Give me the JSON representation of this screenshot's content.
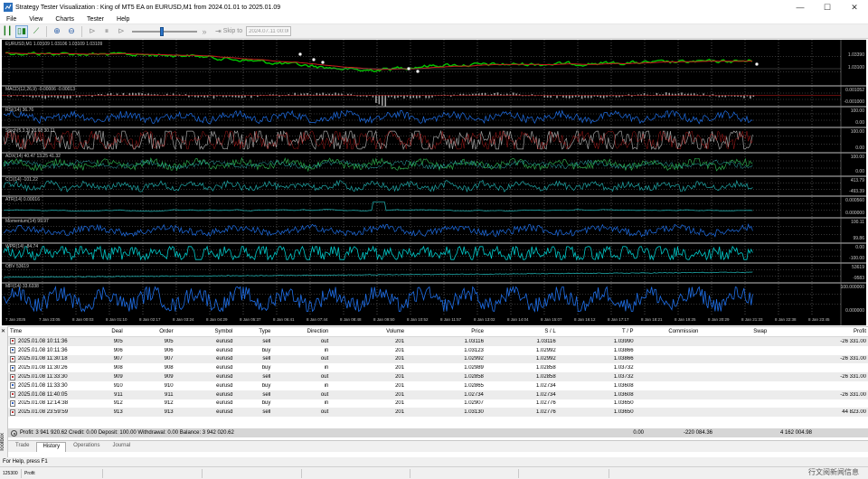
{
  "window": {
    "title": "Strategy Tester Visualization : King of MT5 EA on EURUSD,M1 from 2024.01.01 to 2025.01.09",
    "min": "—",
    "max": "☐",
    "close": "✕"
  },
  "menu": [
    "File",
    "View",
    "Charts",
    "Tester",
    "Help"
  ],
  "toolbar": {
    "skip_label": "Skip to",
    "date_value": "2024.07.11 00:00"
  },
  "speed_slider_value": 0.45,
  "chart": {
    "main_label": "EURUSD,M1   1.03109  1.03106  1.03109  1.03109",
    "main_scale": [
      "1.03390",
      "1.03100"
    ],
    "panels": [
      {
        "label": "MACD(12,26,9) -0.00006 -0.00013",
        "scale": [
          "0.001052",
          "-0.001000"
        ]
      },
      {
        "label": "RSI(14) 36.76",
        "scale": [
          "100.00",
          "0.00"
        ]
      },
      {
        "label": "Stoch(5,3,3) 20.68 30.11",
        "scale": [
          "100.00",
          "0.00"
        ]
      },
      {
        "label": "ADX(14) 40.47 13.25 41.32",
        "scale": [
          "100.00",
          "0.00"
        ]
      },
      {
        "label": "CCI(14) -101.22",
        "scale": [
          "413.79",
          "-493.39"
        ]
      },
      {
        "label": "ATR(14) 0.00016",
        "scale": [
          "0.000560",
          "0.000000"
        ]
      },
      {
        "label": "Momentum(14) 99.97",
        "scale": [
          "100.11",
          "99.86"
        ]
      },
      {
        "label": "WPR(14) -84.74",
        "scale": [
          "0.00",
          "-100.00"
        ]
      },
      {
        "label": "OBV 53619",
        "scale": [
          "53619",
          "-9583"
        ]
      },
      {
        "label": "MFI(14) 33.6338",
        "scale": [
          "100.000000",
          "0.000000"
        ]
      }
    ],
    "xaxis": [
      "7 Jan 2025",
      "7 Jan 23:05",
      "8 Jan 00:03",
      "8 Jan 01:10",
      "8 Jan 02:17",
      "8 Jan 03:24",
      "8 Jan 04:29",
      "8 Jan 05:37",
      "8 Jan 06:41",
      "8 Jan 07:44",
      "8 Jan 08:48",
      "8 Jan 09:50",
      "8 Jan 10:52",
      "8 Jan 11:57",
      "8 Jan 13:02",
      "8 Jan 14:04",
      "8 Jan 15:07",
      "8 Jan 16:12",
      "8 Jan 17:17",
      "8 Jan 18:21",
      "8 Jan 19:25",
      "8 Jan 20:29",
      "8 Jan 21:33",
      "8 Jan 22:38",
      "8 Jan 23:45"
    ],
    "colors": {
      "background": "#000000",
      "grid": "#b4b4b4",
      "price_green": "#00c800",
      "price_red": "#c81e1e",
      "indicator_blue": "#1f6fe8",
      "indicator_cyan": "#00c8c8",
      "indicator_gray": "#a0a0a0"
    }
  },
  "table": {
    "headers": [
      "Time",
      "Deal",
      "Order",
      "Symbol",
      "Type",
      "Direction",
      "Volume",
      "Price",
      "S / L",
      "T / P",
      "Commission",
      "Swap",
      "Profit"
    ],
    "rows": [
      {
        "time": "2025.01.08 10:11:36",
        "deal": "905",
        "order": "905",
        "symbol": "eurusd",
        "type": "sell",
        "direction": "out",
        "volume": "201",
        "price": "1.03116",
        "sl": "1.03116",
        "tp": "1.03990",
        "commission": "",
        "swap": "",
        "profit": "-26 331.00"
      },
      {
        "time": "2025.01.08 10:11:36",
        "deal": "906",
        "order": "906",
        "symbol": "eurusd",
        "type": "buy",
        "direction": "in",
        "volume": "201",
        "price": "1.03123",
        "sl": "1.02992",
        "tp": "1.03866",
        "commission": "",
        "swap": "",
        "profit": ""
      },
      {
        "time": "2025.01.08 11:30:18",
        "deal": "907",
        "order": "907",
        "symbol": "eurusd",
        "type": "sell",
        "direction": "out",
        "volume": "201",
        "price": "1.02992",
        "sl": "1.02992",
        "tp": "1.03866",
        "commission": "",
        "swap": "",
        "profit": "-26 331.00"
      },
      {
        "time": "2025.01.08 11:30:26",
        "deal": "908",
        "order": "908",
        "symbol": "eurusd",
        "type": "buy",
        "direction": "in",
        "volume": "201",
        "price": "1.02989",
        "sl": "1.02858",
        "tp": "1.03732",
        "commission": "",
        "swap": "",
        "profit": ""
      },
      {
        "time": "2025.01.08 11:33:30",
        "deal": "909",
        "order": "909",
        "symbol": "eurusd",
        "type": "sell",
        "direction": "out",
        "volume": "201",
        "price": "1.02858",
        "sl": "1.02858",
        "tp": "1.03732",
        "commission": "",
        "swap": "",
        "profit": "-26 331.00"
      },
      {
        "time": "2025.01.08 11:33:30",
        "deal": "910",
        "order": "910",
        "symbol": "eurusd",
        "type": "buy",
        "direction": "in",
        "volume": "201",
        "price": "1.02865",
        "sl": "1.02734",
        "tp": "1.03608",
        "commission": "",
        "swap": "",
        "profit": ""
      },
      {
        "time": "2025.01.08 11:40:05",
        "deal": "911",
        "order": "911",
        "symbol": "eurusd",
        "type": "sell",
        "direction": "out",
        "volume": "201",
        "price": "1.02734",
        "sl": "1.02734",
        "tp": "1.03608",
        "commission": "",
        "swap": "",
        "profit": "-26 331.00"
      },
      {
        "time": "2025.01.08 12:14:38",
        "deal": "912",
        "order": "912",
        "symbol": "eurusd",
        "type": "buy",
        "direction": "in",
        "volume": "201",
        "price": "1.02907",
        "sl": "1.02776",
        "tp": "1.03650",
        "commission": "",
        "swap": "",
        "profit": ""
      },
      {
        "time": "2025.01.08 23:59:59",
        "deal": "913",
        "order": "913",
        "symbol": "eurusd",
        "type": "sell",
        "direction": "out",
        "volume": "201",
        "price": "1.03130",
        "sl": "1.02776",
        "tp": "1.03650",
        "commission": "",
        "swap": "",
        "profit": "44 823.00"
      }
    ],
    "summary": {
      "text": "Profit: 3 941 920.62   Credit: 0.00   Deposit: 100.00   Withdrawal: 0.00   Balance: 3 942 020.62",
      "commission": "0.00",
      "swap": "-220 084.36",
      "profit": "4 162 004.98"
    }
  },
  "tabs": [
    "Trade",
    "History",
    "Operations",
    "Journal"
  ],
  "active_tab": "History",
  "sidebar_label": "Toolbox",
  "status": {
    "help": "For Help, press F1",
    "cells": [
      "125300",
      "Profit"
    ]
  },
  "watermark": "行文阅新闻信息"
}
